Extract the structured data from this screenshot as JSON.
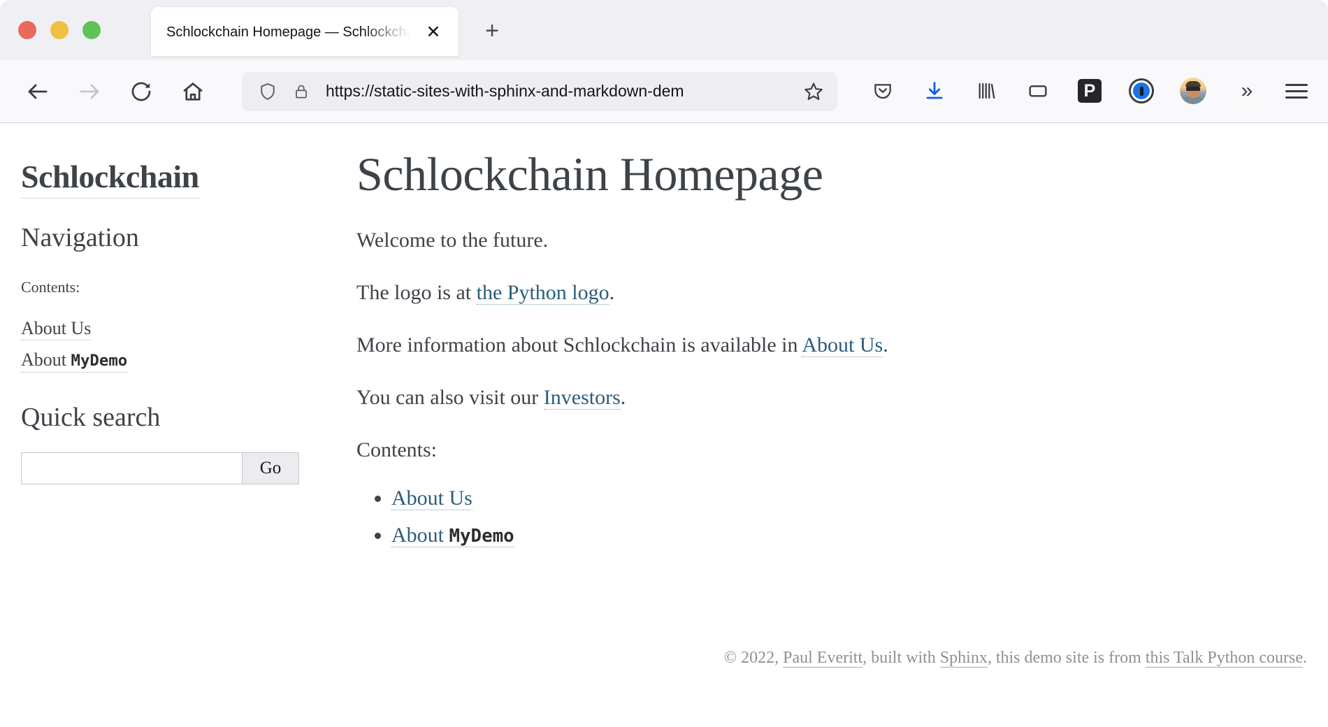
{
  "browser": {
    "tab": {
      "title": "Schlockchain Homepage — Schlockchain",
      "close_label": "✕",
      "newtab_label": "+"
    },
    "nav": {
      "back_label": "Back",
      "forward_label": "Forward",
      "reload_label": "Reload",
      "home_label": "Home"
    },
    "urlbar": {
      "url": "https://static-sites-with-sphinx-and-markdown-dem",
      "shield_icon": "shield-icon",
      "lock_icon": "lock-icon",
      "star_icon": "star-icon"
    },
    "toolbar_items": [
      {
        "name": "pocket-icon",
        "label": "Pocket"
      },
      {
        "name": "downloads-icon",
        "label": "Downloads"
      },
      {
        "name": "library-icon",
        "label": "Library"
      },
      {
        "name": "container-tab-icon",
        "label": "Container Tab"
      },
      {
        "name": "pinboard-extension-icon",
        "label": "P"
      },
      {
        "name": "onepassword-icon",
        "label": "1Password"
      },
      {
        "name": "avatar",
        "label": "Account"
      },
      {
        "name": "overflow-chevrons-icon",
        "label": "»"
      },
      {
        "name": "app-menu-icon",
        "label": "Open application menu"
      }
    ]
  },
  "sidebar": {
    "brand": "Schlockchain",
    "nav_heading": "Navigation",
    "contents_label": "Contents:",
    "links": [
      {
        "text": "About Us",
        "mono": ""
      },
      {
        "text": "About ",
        "mono": "MyDemo"
      }
    ],
    "search_heading": "Quick search",
    "search_value": "",
    "search_placeholder": "",
    "search_button": "Go"
  },
  "main": {
    "title": "Schlockchain Homepage",
    "p1": "Welcome to the future.",
    "p2_pre": "The logo is at ",
    "p2_link": "the Python logo",
    "p2_post": ".",
    "p3_pre": "More information about Schlockchain is available in ",
    "p3_link": "About Us",
    "p3_post": ".",
    "p4_pre": "You can also visit our ",
    "p4_link": "Investors",
    "p4_post": ".",
    "contents_label": "Contents:",
    "contents_items": [
      {
        "text": "About Us",
        "mono": ""
      },
      {
        "text": "About ",
        "mono": "MyDemo"
      }
    ]
  },
  "footer": {
    "copyright": "© 2022, ",
    "author": "Paul Everitt",
    "mid": ", built with ",
    "generator": "Sphinx",
    "mid2": ", this demo site is from ",
    "course": "this Talk Python course",
    "end": "."
  },
  "colors": {
    "link": "#2c5d7c",
    "text": "#3e4349",
    "footer_text": "#909090",
    "chrome_tabstrip": "#f0f0f4",
    "chrome_navbar": "#f9f9fb",
    "urlbar_bg": "#eeeef2",
    "traffic_red": "#e8695e",
    "traffic_yellow": "#f0c040",
    "traffic_green": "#5fc455",
    "download_blue": "#0a60df"
  }
}
